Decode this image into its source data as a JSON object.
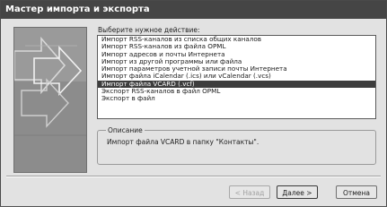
{
  "window": {
    "title": "Мастер импорта и экспорта"
  },
  "prompt": "Выберите нужное действие:",
  "actions": [
    "Импорт RSS-каналов из списка общих каналов",
    "Импорт RSS-каналов из файла OPML",
    "Импорт адресов и почты Интернета",
    "Импорт из другой программы или файла",
    "Импорт параметров учетной записи почты Интернета",
    "Импорт файла iCalendar (.ics) или vCalendar (.vcs)",
    "Импорт файла VCARD (.vcf)",
    "Экспорт RSS-каналов в файл OPML",
    "Экспорт в файл"
  ],
  "selected_index": 6,
  "description_group": {
    "label": "Описание",
    "text": "Импорт файла VCARD в папку \"Контакты\"."
  },
  "buttons": {
    "back": "< Назад",
    "next": "Далее >",
    "cancel": "Отмена"
  }
}
